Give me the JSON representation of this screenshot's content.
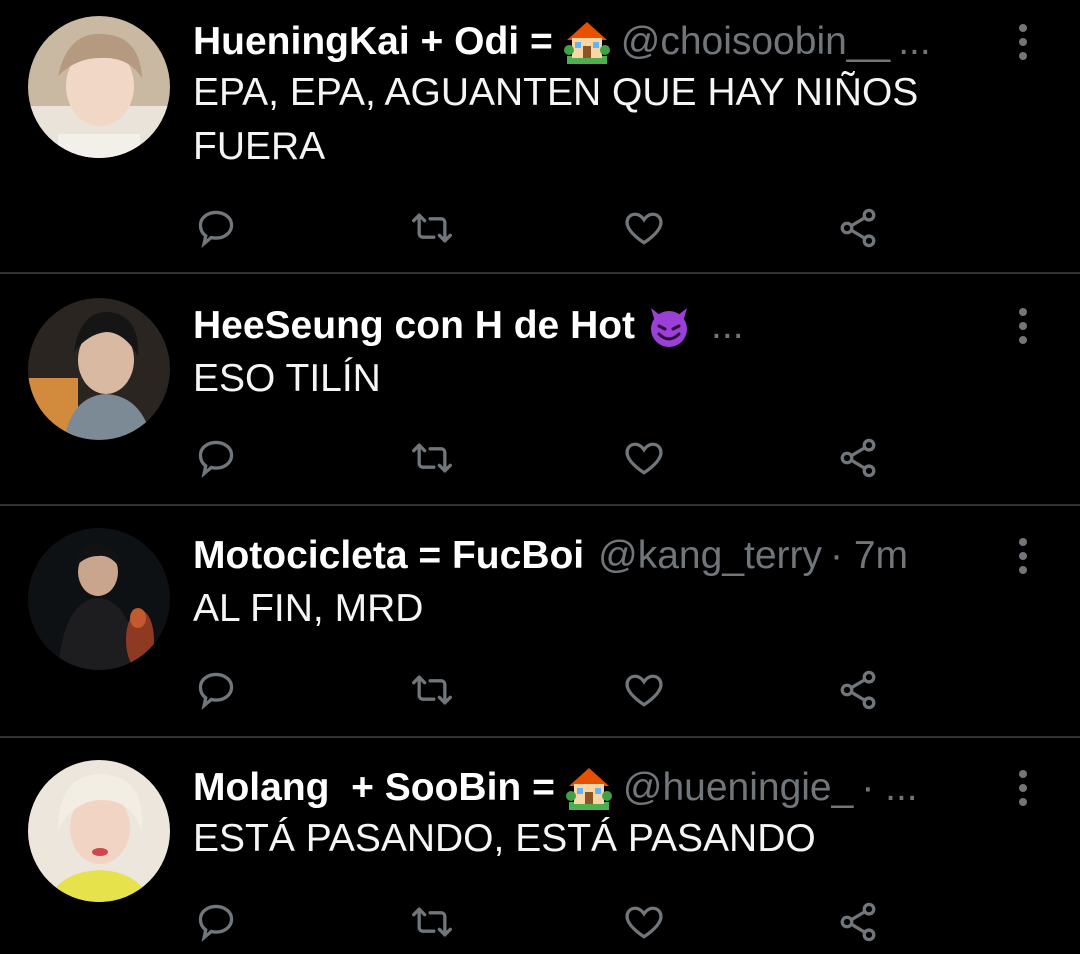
{
  "colors": {
    "background": "#000000",
    "divider": "#2f3336",
    "muted": "#71767b",
    "text": "#e7e9ea"
  },
  "tweets": [
    {
      "name": "HueningKai + Odi =",
      "emoji": "house-with-garden",
      "handle": "@choisoobin__",
      "meta": "...",
      "text": "EPA, EPA, AGUANTEN QUE HAY NIÑOS\nFUERA"
    },
    {
      "name": "HeeSeung con H de Hot",
      "emoji": "smiling-devil",
      "handle": "",
      "meta": "...",
      "text": "ESO TILÍN"
    },
    {
      "name": "Motocicleta = FucBoi",
      "emoji": "",
      "handle": "@kang_terry",
      "meta": "· 7m",
      "text": "AL FIN, MRD"
    },
    {
      "name": "Molang  + SooBin =",
      "emoji": "house-with-garden",
      "handle": "@hueningie_",
      "meta": "· ...",
      "text": "ESTÁ PASANDO, ESTÁ PASANDO"
    }
  ],
  "actions": [
    "reply-icon",
    "retweet-icon",
    "like-icon",
    "share-icon"
  ]
}
